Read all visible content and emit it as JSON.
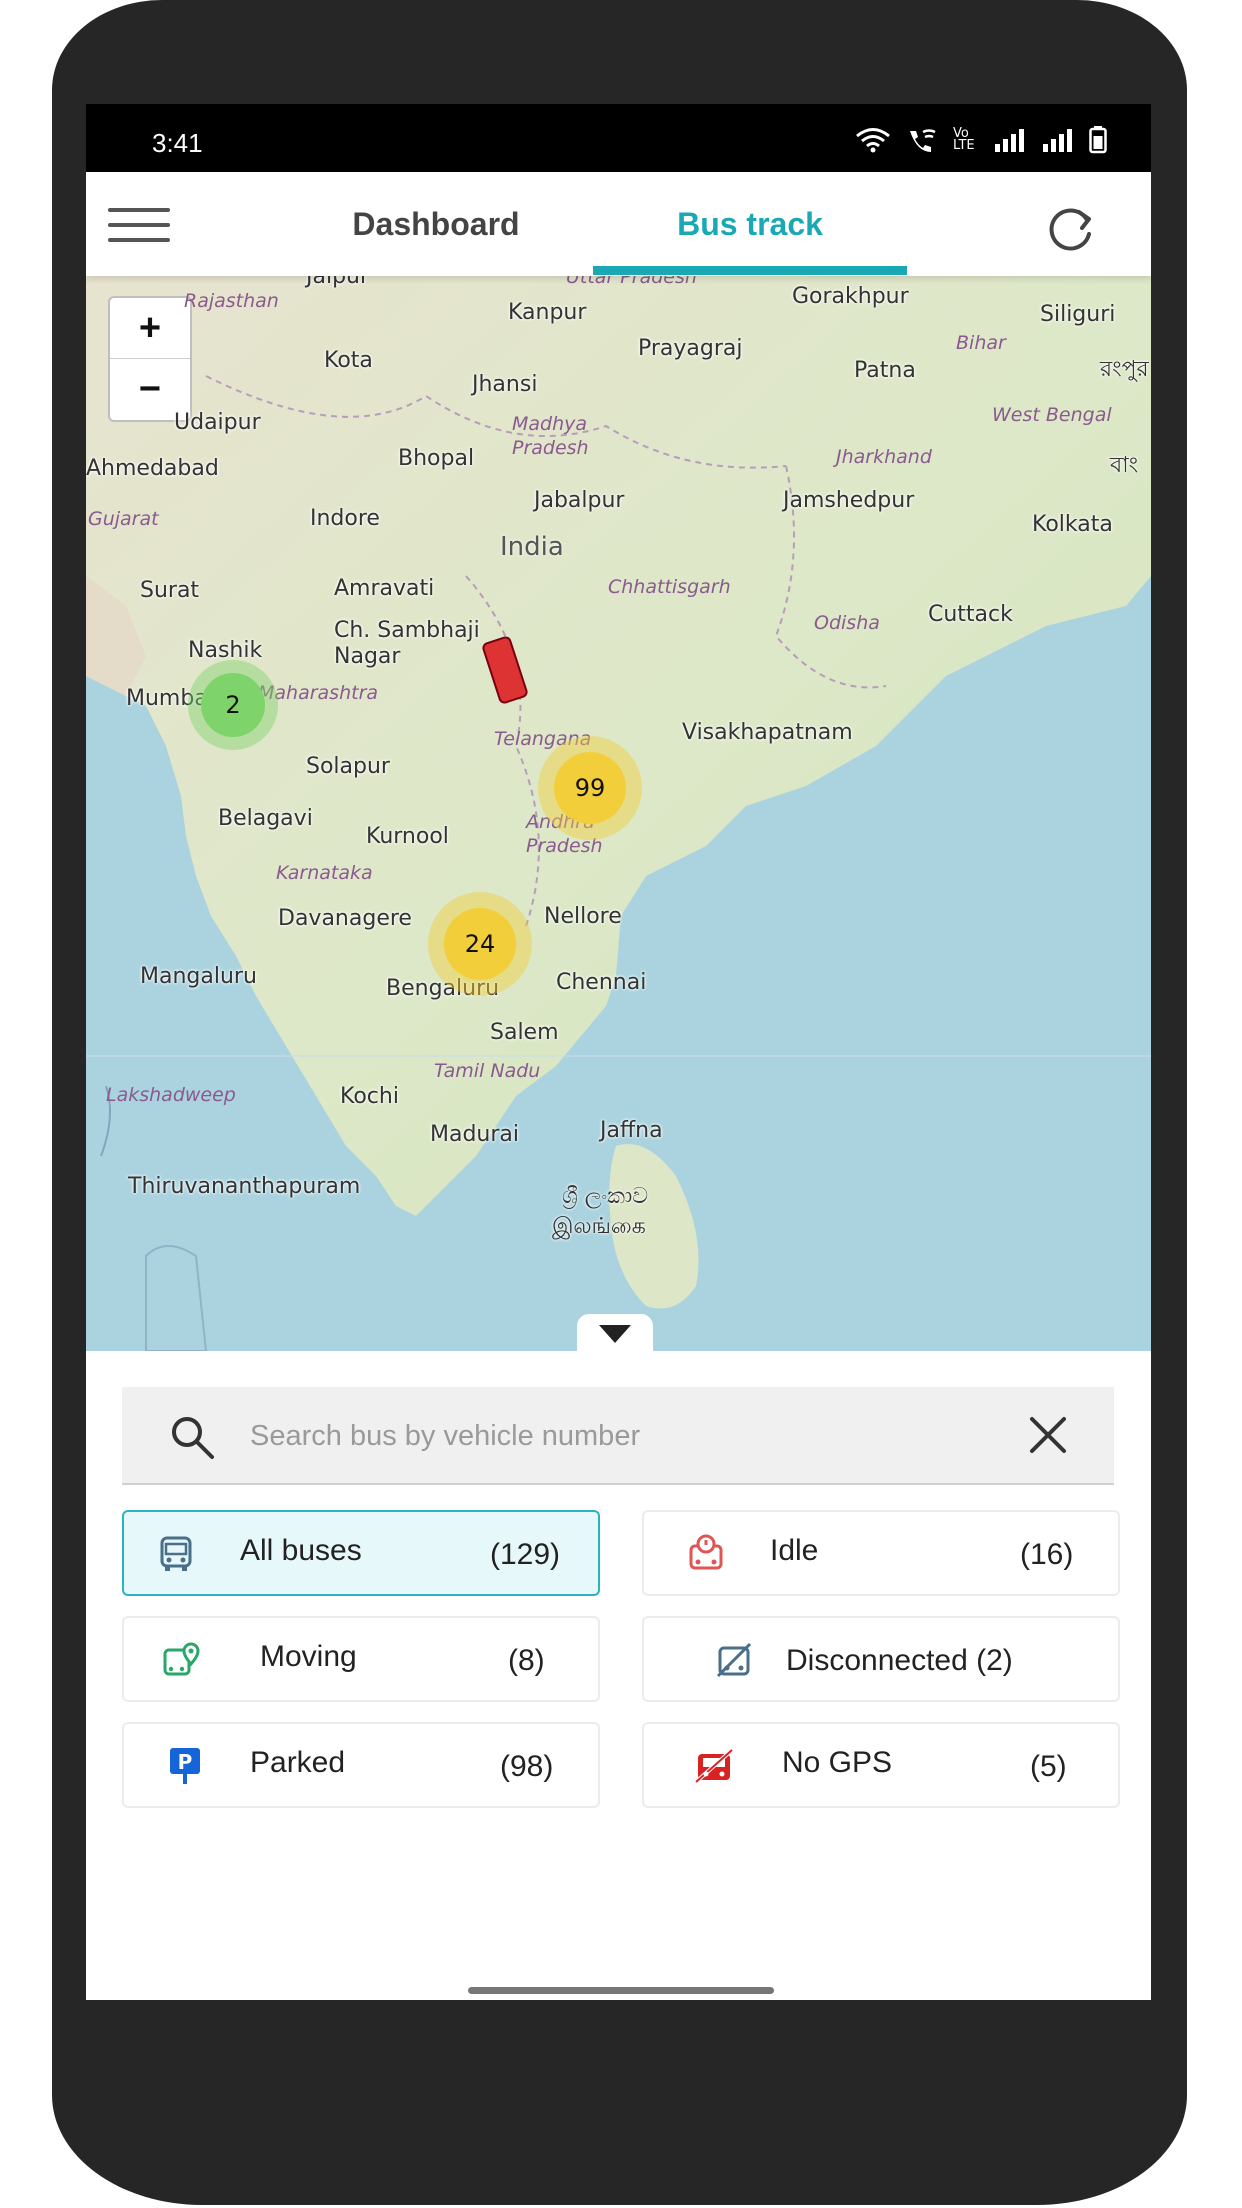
{
  "status_bar": {
    "time": "3:41",
    "network_label": "Vo LTE"
  },
  "header": {
    "tabs": [
      {
        "label": "Dashboard",
        "active": false
      },
      {
        "label": "Bus track",
        "active": true
      }
    ],
    "accent_color": "#1aa8b4"
  },
  "map": {
    "zoom_in": "+",
    "zoom_out": "−",
    "country_label": "India",
    "places": [
      "Jaipur",
      "Uttar Pradesh",
      "Gorakhpur",
      "Rajasthan",
      "Kanpur",
      "Siliguri",
      "Bihar",
      "Prayagraj",
      "Kota",
      "Patna",
      "রংপুর",
      "Jhansi",
      "Udaipur",
      "Madhya Pradesh",
      "West Bengal",
      "Ahmedabad",
      "Bhopal",
      "Jharkhand",
      "বাং",
      "Gujarat",
      "Jabalpur",
      "Jamshedpur",
      "Indore",
      "Kolkata",
      "Surat",
      "Amravati",
      "Chhattisgarh",
      "Cuttack",
      "Odisha",
      "Ch. Sambhaji Nagar",
      "Nashik",
      "Mumbai",
      "Maharashtra",
      "Telangana",
      "Visakhapatnam",
      "Solapur",
      "Belagavi",
      "Kurnool",
      "Andhra Pradesh",
      "Karnataka",
      "Davanagere",
      "Nellore",
      "Mangaluru",
      "Bengaluru",
      "Chennai",
      "Salem",
      "Tamil Nadu",
      "Lakshadweep",
      "Kochi",
      "Madurai",
      "Jaffna",
      "Thiruvananthapuram",
      "ශ්‍රී ලංකාව",
      "இலங்கை"
    ],
    "clusters": [
      {
        "count": "2",
        "color": "#7ed36a"
      },
      {
        "count": "99",
        "color": "#f2cf3a"
      },
      {
        "count": "24",
        "color": "#f2cf3a"
      }
    ]
  },
  "search": {
    "placeholder": "Search bus by vehicle number",
    "value": ""
  },
  "filters": [
    {
      "label": "All buses",
      "count": "(129)",
      "icon": "bus-icon",
      "active": true,
      "color": "#4a6f8a"
    },
    {
      "label": "Idle",
      "count": "(16)",
      "icon": "idle-bus-icon",
      "active": false,
      "color": "#e05555"
    },
    {
      "label": "Moving",
      "count": "(8)",
      "icon": "moving-bus-icon",
      "active": false,
      "color": "#2aa66a"
    },
    {
      "label": "Disconnected (2)",
      "count": "",
      "icon": "disconnected-bus-icon",
      "active": false,
      "color": "#4a6f8a"
    },
    {
      "label": "Parked",
      "count": "(98)",
      "icon": "parking-icon",
      "active": false,
      "color": "#1565d8"
    },
    {
      "label": "No GPS",
      "count": "(5)",
      "icon": "no-gps-icon",
      "active": false,
      "color": "#d92323"
    }
  ]
}
